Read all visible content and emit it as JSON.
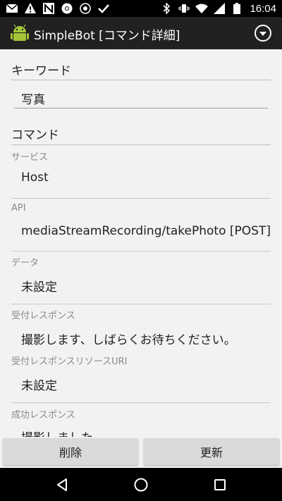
{
  "status_bar": {
    "time": "16:04",
    "left_icons": [
      "mail-icon",
      "alert-icon",
      "n-icon",
      "chrome-icon",
      "location-icon",
      "check-icon"
    ],
    "right_icons": [
      "bluetooth-icon",
      "vibrate-icon",
      "wifi-icon",
      "signal-icon",
      "battery-icon"
    ]
  },
  "app_bar": {
    "title": "SimpleBot [コマンド詳細]",
    "app_icon": "android-icon",
    "menu_icon": "dropdown-circle-icon"
  },
  "keyword_section": {
    "header": "キーワード",
    "value": "写真"
  },
  "command_section": {
    "header": "コマンド",
    "fields": [
      {
        "label": "サービス",
        "value": "Host"
      },
      {
        "label": "API",
        "value": "mediaStreamRecording/takePhoto [POST]"
      },
      {
        "label": "データ",
        "value": "未設定"
      },
      {
        "label": "受付レスポンス",
        "value": "撮影します、しばらくお待ちください。"
      },
      {
        "label": "受付レスポンスリソースURI",
        "value": "未設定"
      },
      {
        "label": "成功レスポンス",
        "value": "撮影しました"
      }
    ]
  },
  "buttons": {
    "delete_label": "削除",
    "update_label": "更新"
  },
  "nav_bar": {
    "icons": [
      "back-icon",
      "home-icon",
      "recents-icon"
    ]
  },
  "colors": {
    "app_bar": "#212121",
    "background": "#f2f2f2",
    "button": "#d9d9d9",
    "android_green": "#a4c639"
  }
}
